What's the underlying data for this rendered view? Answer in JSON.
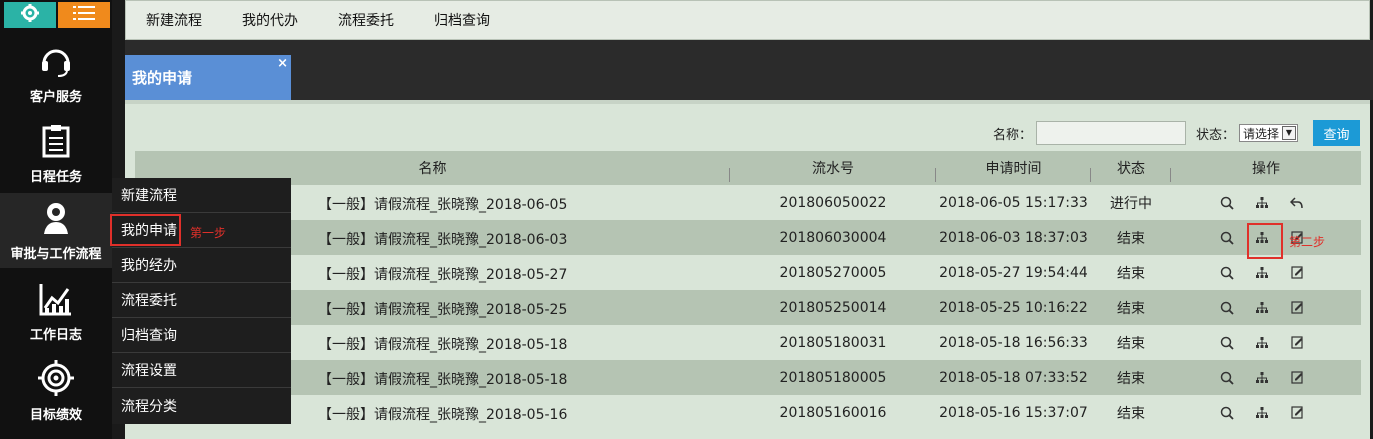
{
  "sidebar": {
    "top_icons": [
      "gear-icon",
      "list-icon"
    ],
    "top_colors": {
      "gear": "#2bb3a6",
      "list": "#f08a1c"
    },
    "items": [
      {
        "label": "客户服务",
        "icon": "headset-icon"
      },
      {
        "label": "日程任务",
        "icon": "clipboard-icon"
      },
      {
        "label": "审批与工作流程",
        "icon": "workflow-person-icon"
      },
      {
        "label": "工作日志",
        "icon": "chart-icon"
      },
      {
        "label": "目标绩效",
        "icon": "target-icon"
      }
    ]
  },
  "topnav": {
    "items": [
      "新建流程",
      "我的代办",
      "流程委托",
      "归档查询"
    ]
  },
  "tab": {
    "label": "我的申请",
    "close": "×"
  },
  "search": {
    "name_label": "名称：",
    "name_value": "",
    "status_label": "状态：",
    "status_value": "请选择",
    "query_button": "查询"
  },
  "table": {
    "headers": [
      "名称",
      "流水号",
      "申请时间",
      "状态",
      "操作"
    ],
    "rows": [
      {
        "name": "【一般】请假流程_张晓豫_2018-06-05",
        "serial": "201806050022",
        "time": "2018-06-05 15:17:33",
        "status": "进行中",
        "ops": [
          "search-icon",
          "org-chart-icon",
          "revoke-icon"
        ]
      },
      {
        "name": "【一般】请假流程_张晓豫_2018-06-03",
        "serial": "201806030004",
        "time": "2018-06-03 18:37:03",
        "status": "结束",
        "ops": [
          "search-icon",
          "org-chart-icon",
          "edit-icon"
        ]
      },
      {
        "name": "【一般】请假流程_张晓豫_2018-05-27",
        "serial": "201805270005",
        "time": "2018-05-27 19:54:44",
        "status": "结束",
        "ops": [
          "search-icon",
          "org-chart-icon",
          "edit-icon"
        ]
      },
      {
        "name": "【一般】请假流程_张晓豫_2018-05-25",
        "serial": "201805250014",
        "time": "2018-05-25 10:16:22",
        "status": "结束",
        "ops": [
          "search-icon",
          "org-chart-icon",
          "edit-icon"
        ]
      },
      {
        "name": "【一般】请假流程_张晓豫_2018-05-18",
        "serial": "201805180031",
        "time": "2018-05-18 16:56:33",
        "status": "结束",
        "ops": [
          "search-icon",
          "org-chart-icon",
          "edit-icon"
        ]
      },
      {
        "name": "【一般】请假流程_张晓豫_2018-05-18",
        "serial": "201805180005",
        "time": "2018-05-18 07:33:52",
        "status": "结束",
        "ops": [
          "search-icon",
          "org-chart-icon",
          "edit-icon"
        ]
      },
      {
        "name": "【一般】请假流程_张晓豫_2018-05-16",
        "serial": "201805160016",
        "time": "2018-05-16 15:37:07",
        "status": "结束",
        "ops": [
          "search-icon",
          "org-chart-icon",
          "edit-icon"
        ]
      }
    ]
  },
  "popup_menu": {
    "items": [
      "新建流程",
      "我的申请",
      "我的经办",
      "流程委托",
      "归档查询",
      "流程设置",
      "流程分类"
    ],
    "highlighted_index": 1
  },
  "annotations": {
    "step1": "第一步",
    "step2": "第二步",
    "color": "#e0302a"
  }
}
